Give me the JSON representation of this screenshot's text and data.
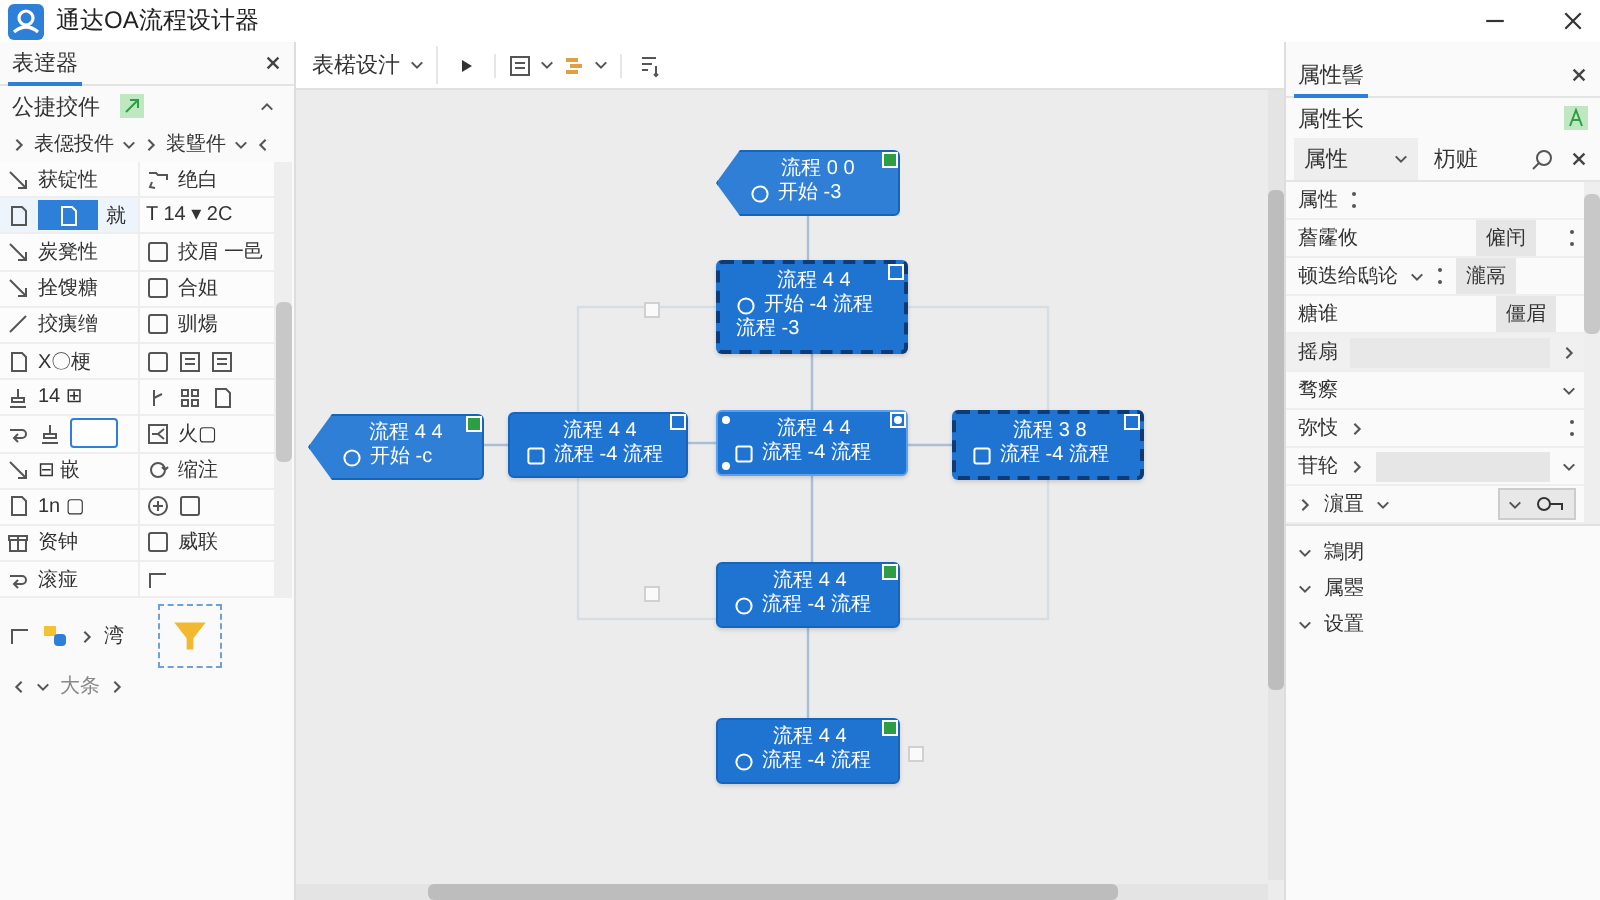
{
  "window": {
    "title": "通达OA流程设计器"
  },
  "left_panel": {
    "tab": "表逹器",
    "section": "公捷挍件",
    "column_headers": [
      "表僫投件",
      "装曁件"
    ],
    "column_1": [
      {
        "kind": "tool",
        "text": "获锭性",
        "selected": false
      },
      {
        "kind": "tool",
        "text": "就",
        "selected": true
      },
      {
        "kind": "tool",
        "text": "炭凳性",
        "selected": false
      },
      {
        "kind": "tool",
        "text": "拴馊糖",
        "selected": false
      },
      {
        "kind": "tool",
        "text": "挍痍缯",
        "selected": false
      },
      {
        "kind": "tool",
        "text": "X〇梗",
        "selected": false
      },
      {
        "kind": "tool",
        "text": "14 ⊞",
        "selected": false
      },
      {
        "kind": "field",
        "selected": false
      },
      {
        "kind": "tool",
        "text": "⊟ 嵌",
        "selected": false
      },
      {
        "kind": "tool",
        "text": "1n ▢",
        "selected": false
      },
      {
        "kind": "tool",
        "text": "资钟",
        "selected": false
      },
      {
        "kind": "tool",
        "text": "滚痖",
        "selected": false
      }
    ],
    "column_2": [
      {
        "kind": "tool",
        "text": "绝白",
        "selected": false
      },
      {
        "kind": "tool",
        "text": "T 14 ▾ 2C",
        "selected": false
      },
      {
        "kind": "tool",
        "text": "挍眉 一邑",
        "selected": false
      },
      {
        "kind": "tool",
        "text": "合姐",
        "selected": false
      },
      {
        "kind": "tool",
        "text": "驯煬",
        "selected": false
      },
      {
        "kind": "icons",
        "selected": false
      },
      {
        "kind": "icons",
        "selected": false
      },
      {
        "kind": "tool",
        "text": "火▢",
        "selected": false
      },
      {
        "kind": "tool",
        "text": "缩注",
        "selected": false
      },
      {
        "kind": "icons",
        "selected": false
      },
      {
        "kind": "tool",
        "text": "威联",
        "selected": false
      },
      {
        "kind": "icons",
        "selected": false
      }
    ],
    "extra_row": "湾",
    "footer": "大条"
  },
  "toolbar": {
    "design_menu": "表楉设汁"
  },
  "canvas": {
    "nodes": [
      {
        "kind": "tag",
        "title": "流程 0 0",
        "lines": [
          "开始 -3"
        ],
        "selected": false,
        "focused": false,
        "color": "#2e9e44"
      },
      {
        "kind": "box",
        "title": "流程 4 4",
        "lines": [
          "开始 -4 流程",
          "流程 -3"
        ],
        "selected": true,
        "focused": false,
        "color": "#1f74d1"
      },
      {
        "kind": "tag",
        "title": "流程 4 4",
        "lines": [
          "开始 -c"
        ],
        "selected": false,
        "focused": false,
        "color": "#2e9e44"
      },
      {
        "kind": "box",
        "title": "流程 4 4",
        "lines": [
          "流程 -4 流程"
        ],
        "selected": false,
        "focused": false,
        "color": "#1f74d1"
      },
      {
        "kind": "box",
        "title": "流程 4 4",
        "lines": [
          "流程 -4 流程"
        ],
        "selected": false,
        "focused": true,
        "color": "#1f74d1"
      },
      {
        "kind": "box",
        "title": "流程 3 8",
        "lines": [
          "流程 -4 流程"
        ],
        "selected": true,
        "focused": false,
        "color": "#1f74d1"
      },
      {
        "kind": "box",
        "title": "流程 4 4",
        "lines": [
          "流程 -4 流程"
        ],
        "selected": false,
        "focused": false,
        "color": "#2e9e44"
      },
      {
        "kind": "box",
        "title": "流程 4 4",
        "lines": [
          "流程 -4 流程"
        ],
        "selected": false,
        "focused": false,
        "color": "#2e9e44"
      }
    ]
  },
  "properties_panel": {
    "tab": "属性髻",
    "title": "属性长",
    "dropdown": "属性",
    "search_tab": "杤赃",
    "rows": [
      {
        "kind": "label",
        "label": "属性"
      },
      {
        "kind": "button",
        "label": "薝霳攸",
        "button": "僱闬"
      },
      {
        "kind": "dropdown-button",
        "label": "顿迭给鸱论",
        "button": "瀧鬲"
      },
      {
        "kind": "button",
        "label": "糖谁",
        "button": "僵眉"
      },
      {
        "kind": "group",
        "label": "摇扇"
      },
      {
        "kind": "dropdown",
        "label": "骛瘵"
      },
      {
        "kind": "expand",
        "label": "弥忮"
      },
      {
        "kind": "expand-field",
        "label": "苷轮"
      },
      {
        "kind": "key",
        "label": "濵罝"
      }
    ],
    "sections": [
      {
        "label": "鶎閉",
        "expanded": true
      },
      {
        "label": "属瞾",
        "expanded": true
      },
      {
        "label": "设置",
        "expanded": true
      }
    ]
  }
}
